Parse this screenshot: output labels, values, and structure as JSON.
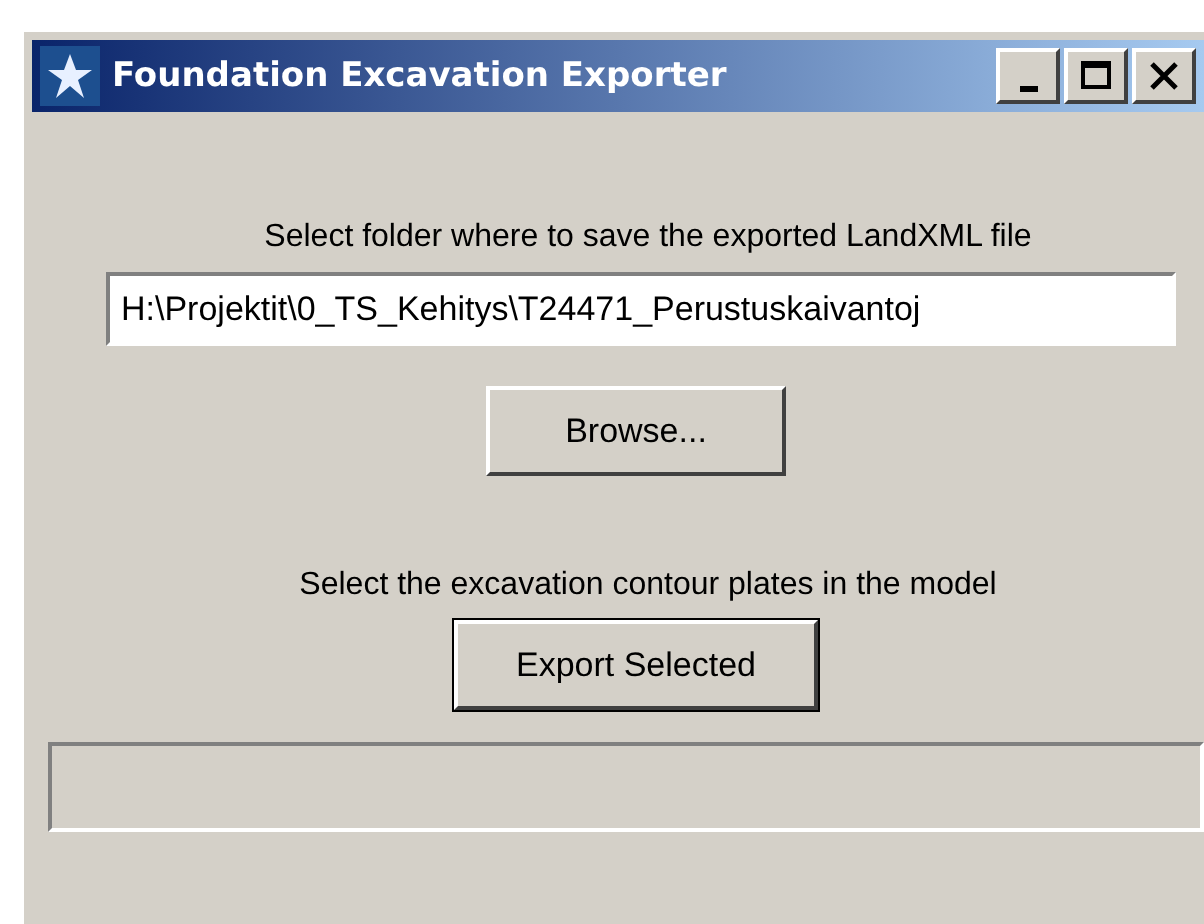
{
  "window": {
    "title": "Foundation Excavation Exporter"
  },
  "folder_label": "Select folder where to save the exported LandXML file",
  "folder_field": {
    "value": "H:\\Projektit\\0_TS_Kehitys\\T24471_Perustuskaivantoj"
  },
  "browse_button": "Browse...",
  "plates_label": "Select the excavation contour plates in the model",
  "export_button": "Export Selected"
}
